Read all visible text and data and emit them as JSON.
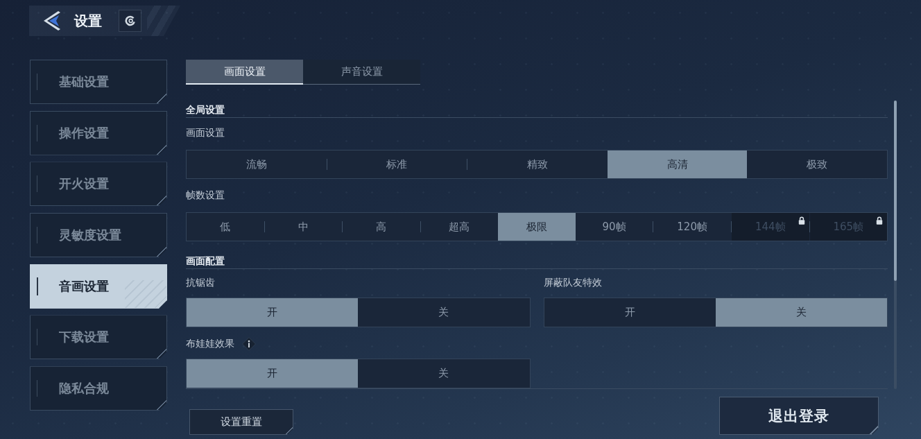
{
  "header": {
    "title": "设置"
  },
  "sidebar": {
    "items": [
      {
        "label": "基础设置",
        "selected": false
      },
      {
        "label": "操作设置",
        "selected": false
      },
      {
        "label": "开火设置",
        "selected": false
      },
      {
        "label": "灵敏度设置",
        "selected": false
      },
      {
        "label": "音画设置",
        "selected": true
      },
      {
        "label": "下载设置",
        "selected": false
      },
      {
        "label": "隐私合规",
        "selected": false
      }
    ]
  },
  "tabs": [
    {
      "label": "画面设置",
      "selected": true
    },
    {
      "label": "声音设置",
      "selected": false
    }
  ],
  "sections": [
    {
      "heading": "全局设置",
      "settings": [
        {
          "kind": "segmented",
          "label": "画面设置",
          "info": false,
          "options": [
            {
              "label": "流畅",
              "selected": false
            },
            {
              "label": "标准",
              "selected": false
            },
            {
              "label": "精致",
              "selected": false
            },
            {
              "label": "高清",
              "selected": true
            },
            {
              "label": "极致",
              "selected": false
            }
          ]
        },
        {
          "kind": "segmented",
          "label": "帧数设置",
          "info": false,
          "options": [
            {
              "label": "低",
              "selected": false,
              "locked": false
            },
            {
              "label": "中",
              "selected": false,
              "locked": false
            },
            {
              "label": "高",
              "selected": false,
              "locked": false
            },
            {
              "label": "超高",
              "selected": false,
              "locked": false
            },
            {
              "label": "极限",
              "selected": true,
              "locked": false
            },
            {
              "label": "90帧",
              "selected": false,
              "locked": false
            },
            {
              "label": "120帧",
              "selected": false,
              "locked": false
            },
            {
              "label": "144帧",
              "selected": false,
              "locked": true
            },
            {
              "label": "165帧",
              "selected": false,
              "locked": true
            }
          ]
        }
      ]
    },
    {
      "heading": "画面配置",
      "settings": [
        {
          "kind": "toggle",
          "label": "抗锯齿",
          "info": false,
          "options": [
            {
              "label": "开",
              "selected": true
            },
            {
              "label": "关",
              "selected": false
            }
          ]
        },
        {
          "kind": "toggle",
          "label": "屏蔽队友特效",
          "info": false,
          "options": [
            {
              "label": "开",
              "selected": false
            },
            {
              "label": "关",
              "selected": true
            }
          ]
        },
        {
          "kind": "toggle",
          "label": "布娃娃效果",
          "info": true,
          "options": [
            {
              "label": "开",
              "selected": true
            },
            {
              "label": "关",
              "selected": false
            }
          ]
        }
      ]
    }
  ],
  "reset_button": {
    "label": "设置重置"
  },
  "logout_button": {
    "label": "退出登录"
  }
}
